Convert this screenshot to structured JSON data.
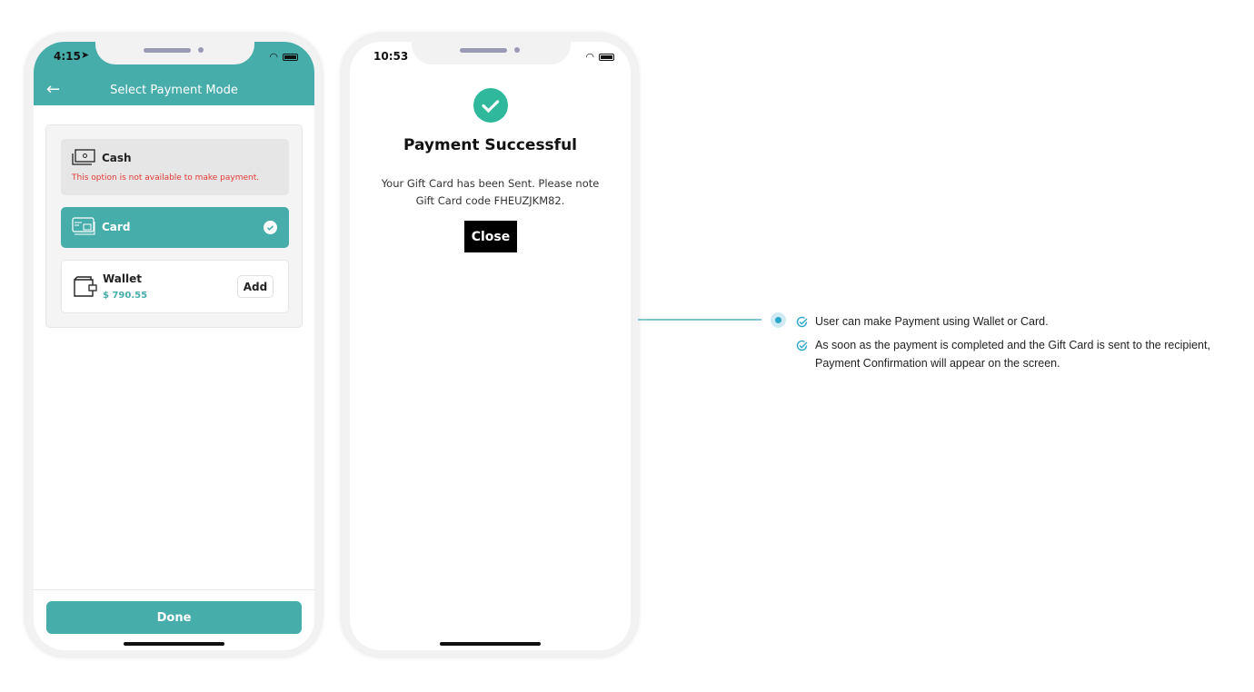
{
  "phone1": {
    "status_time": "4:15",
    "header_title": "Select Payment Mode",
    "options": [
      {
        "name": "Cash",
        "note": "This option is not available to make payment.",
        "icon": "cash-icon",
        "available": false
      },
      {
        "name": "Card",
        "icon": "card-icon",
        "selected": true
      },
      {
        "name": "Wallet",
        "balance": "$ 790.55",
        "icon": "wallet-icon",
        "action": "Add"
      }
    ],
    "done_label": "Done"
  },
  "phone2": {
    "status_time": "10:53",
    "title": "Payment Successful",
    "message_line1": "Your Gift Card has been Sent. Please note",
    "message_line2": "Gift Card code FHEUZJKM82.",
    "close_label": "Close"
  },
  "notes": [
    "User can make Payment using Wallet or Card.",
    "As soon as the payment is completed and the Gift Card is sent to the recipient, Payment Confirmation will appear on the screen."
  ],
  "colors": {
    "teal": "#47adab",
    "success": "#2fb89c",
    "error": "#e53935",
    "accent": "#2aa6c9"
  }
}
